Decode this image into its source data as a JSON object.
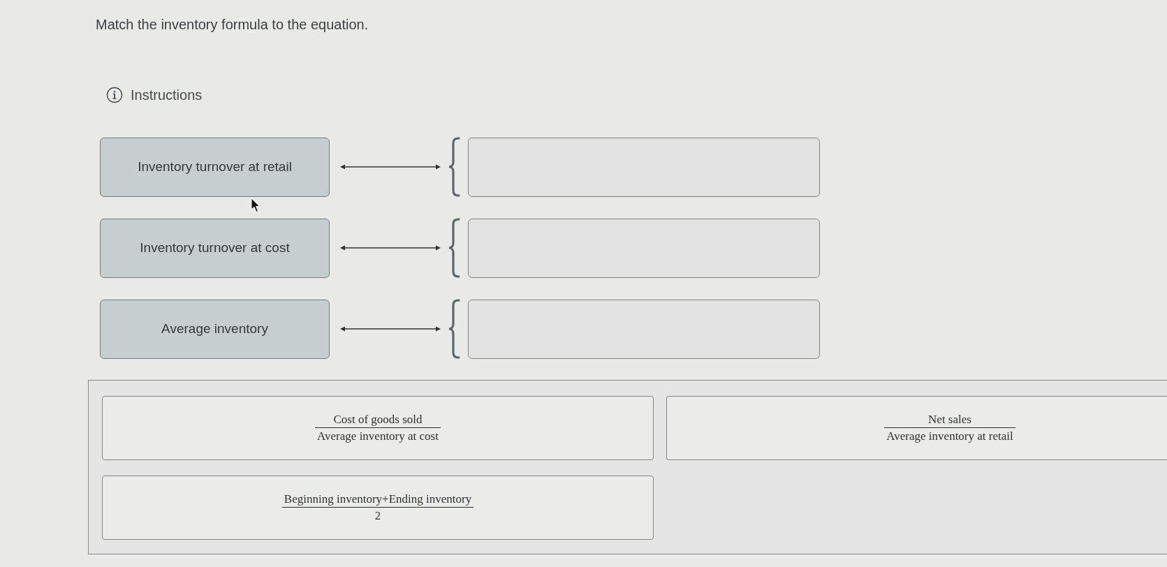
{
  "title": "Match the inventory formula to the equation.",
  "instructions": {
    "label": "Instructions"
  },
  "prompts": [
    {
      "label": "Inventory turnover at retail"
    },
    {
      "label": "Inventory turnover at cost"
    },
    {
      "label": "Average inventory"
    }
  ],
  "choices": [
    {
      "numerator": "Cost of goods sold",
      "denominator": "Average inventory at cost"
    },
    {
      "numerator": "Net sales",
      "denominator": "Average inventory at retail"
    },
    {
      "numerator": "Beginning inventory+Ending inventory",
      "denominator": "2"
    }
  ]
}
